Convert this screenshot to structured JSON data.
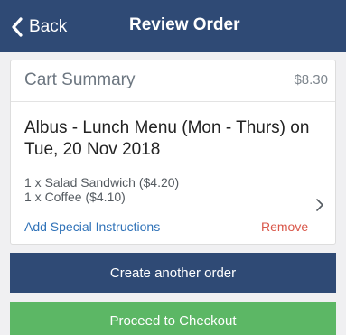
{
  "navbar": {
    "back_label": "Back",
    "title": "Review Order"
  },
  "cart": {
    "summary_title": "Cart Summary",
    "total": "$8.30",
    "order_title": "Albus - Lunch Menu (Mon - Thurs) on Tue, 20 Nov 2018",
    "items": [
      "1 x Salad Sandwich ($4.20)",
      "1 x Coffee ($4.10)"
    ],
    "special_instructions_label": "Add Special Instructions",
    "remove_label": "Remove"
  },
  "buttons": {
    "create_another": "Create another order",
    "checkout": "Proceed to Checkout"
  },
  "colors": {
    "navbar": "#2f4a75",
    "checkout": "#5cb765",
    "link": "#2f72b8",
    "remove": "#d9574a"
  },
  "icons": {
    "back": "chevron-left-icon",
    "detail": "chevron-right-icon"
  }
}
